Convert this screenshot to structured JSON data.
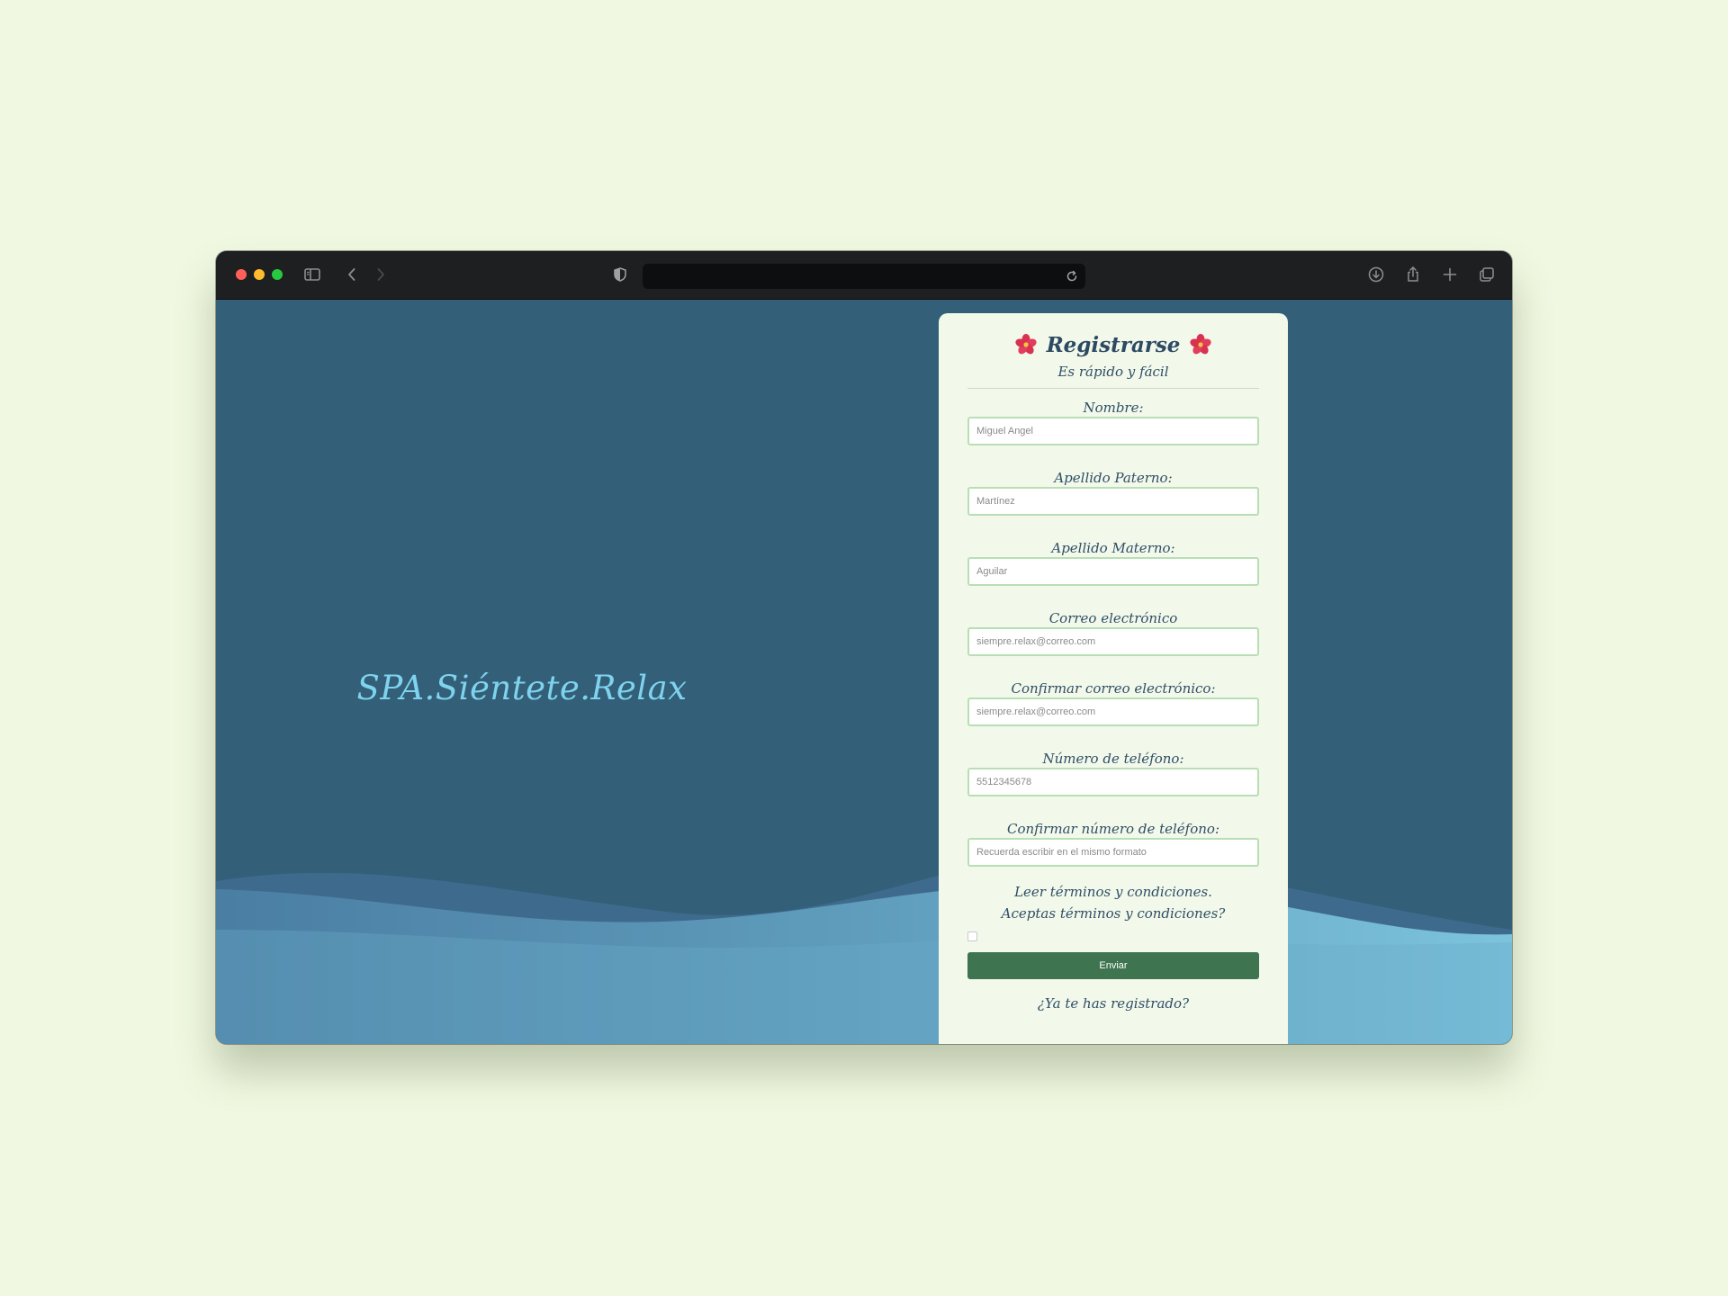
{
  "browser": {
    "icons": {
      "sidebar": "sidebar-icon",
      "back": "chevron-left-icon",
      "forward": "chevron-right-icon",
      "privacy": "shield-icon",
      "reload": "reload-icon",
      "download": "download-icon",
      "share": "share-icon",
      "new_tab": "plus-icon",
      "tabs": "tabs-overview-icon"
    },
    "address": ""
  },
  "hero": {
    "brand": "SPA.Siéntete.Relax"
  },
  "form": {
    "title": "Registrarse",
    "title_icon": "hibiscus-icon",
    "subtitle": "Es rápido y fácil",
    "fields": [
      {
        "label": "Nombre:",
        "placeholder": "Miguel Angel"
      },
      {
        "label": "Apellido Paterno:",
        "placeholder": "Martínez"
      },
      {
        "label": "Apellido Materno:",
        "placeholder": "Aguilar"
      },
      {
        "label": "Correo electrónico",
        "placeholder": "siempre.relax@correo.com"
      },
      {
        "label": "Confirmar correo electrónico:",
        "placeholder": "siempre.relax@correo.com"
      },
      {
        "label": "Número de teléfono:",
        "placeholder": "5512345678"
      },
      {
        "label": "Confirmar número de teléfono:",
        "placeholder": "Recuerda escribir en el mismo formato"
      }
    ],
    "terms_read": "Leer términos y condiciones.",
    "terms_accept": "Aceptas términos y condiciones?",
    "terms_checked": false,
    "submit_label": "Enviar",
    "login_link": "¿Ya te has registrado?"
  },
  "colors": {
    "page_background": "#f0f8e1",
    "site_background": "#335f78",
    "brand_text": "#7fd3ee",
    "card_background": "#f2f8ea",
    "submit_button": "#3e7450",
    "input_border": "#b8dfb4"
  }
}
